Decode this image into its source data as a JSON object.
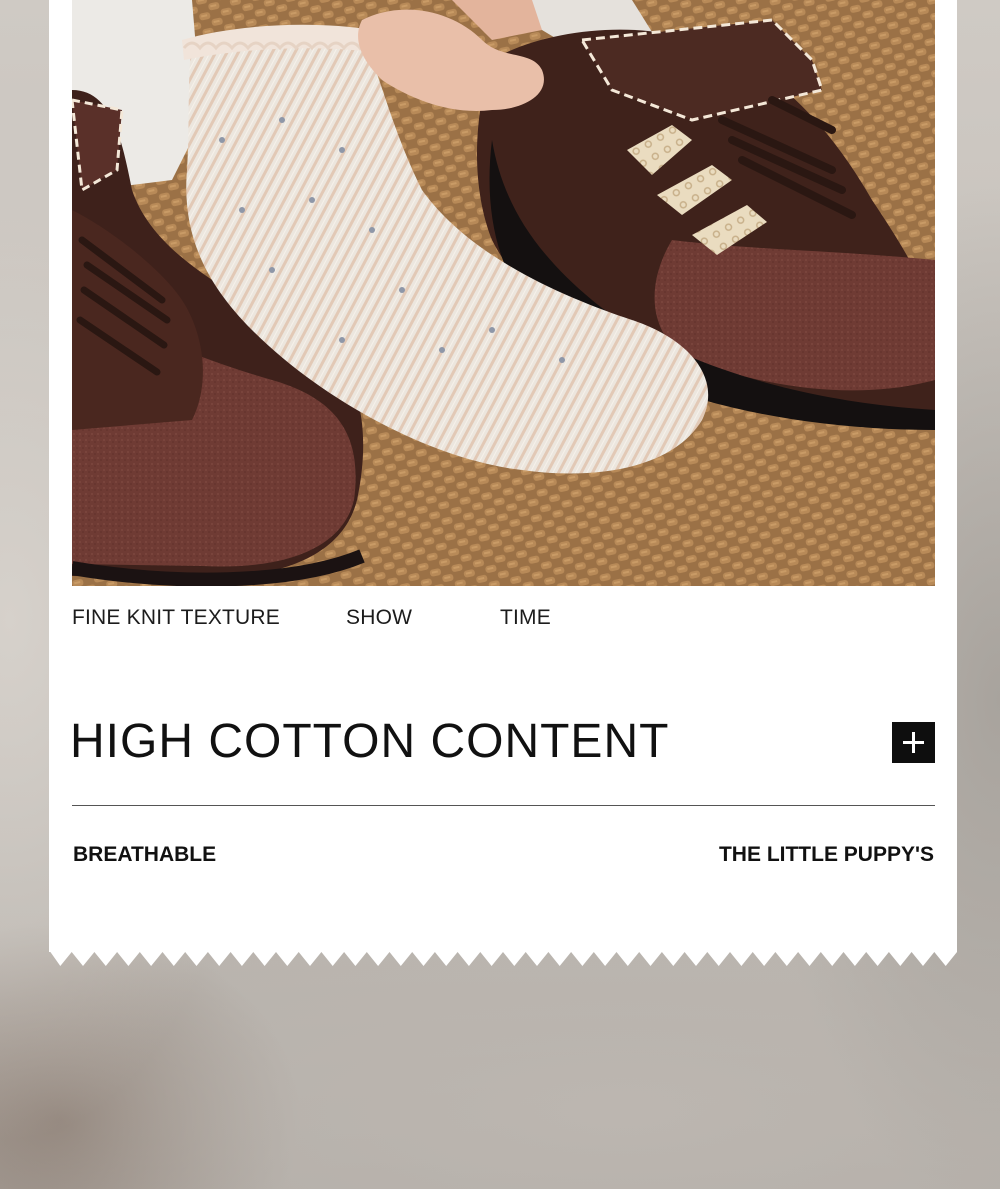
{
  "photo": {
    "subject": ""
  },
  "features": {
    "labels": [
      "FINE KNIT TEXTURE",
      "SHOW",
      "TIME"
    ]
  },
  "headline": "HIGH COTTON CONTENT",
  "expand_button": {
    "icon": "plus-icon"
  },
  "tags": {
    "left": "BREATHABLE",
    "right": "THE LITTLE PUPPY'S"
  },
  "colors": {
    "card": "#ffffff",
    "text": "#111111",
    "button": "#0e0e0e"
  }
}
